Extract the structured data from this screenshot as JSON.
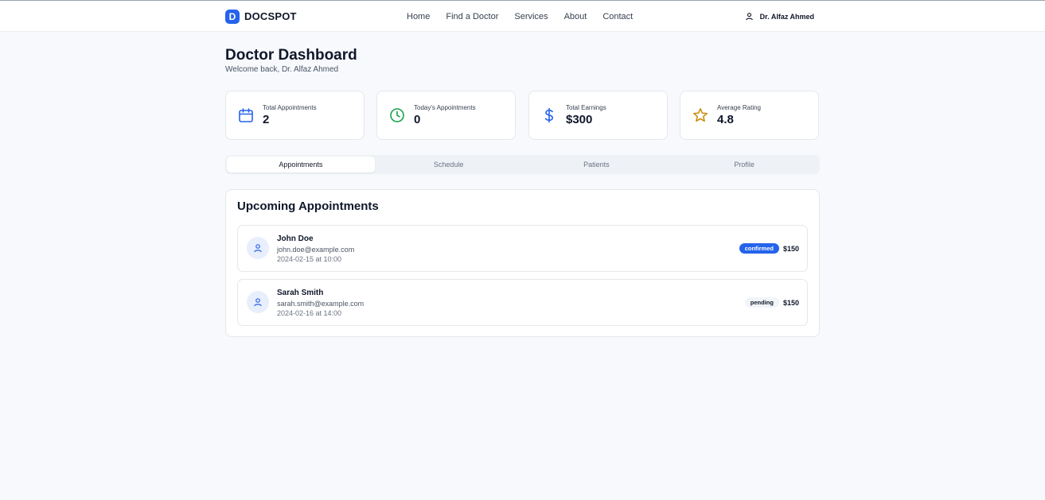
{
  "brand": {
    "logo_letter": "D",
    "name": "DOCSPOT"
  },
  "nav": {
    "links": [
      "Home",
      "Find a Doctor",
      "Services",
      "About",
      "Contact"
    ],
    "user_name": "Dr. Alfaz Ahmed"
  },
  "page": {
    "title": "Doctor Dashboard",
    "subtitle": "Welcome back, Dr. Alfaz Ahmed"
  },
  "stats": [
    {
      "label": "Total Appointments",
      "value": "2",
      "icon": "calendar-icon",
      "color": "#2563eb"
    },
    {
      "label": "Today's Appointments",
      "value": "0",
      "icon": "clock-icon",
      "color": "#16a34a"
    },
    {
      "label": "Total Earnings",
      "value": "$300",
      "icon": "dollar-icon",
      "color": "#2563eb"
    },
    {
      "label": "Average Rating",
      "value": "4.8",
      "icon": "star-icon",
      "color": "#ca8a04"
    }
  ],
  "tabs": [
    {
      "label": "Appointments",
      "active": true
    },
    {
      "label": "Schedule",
      "active": false
    },
    {
      "label": "Patients",
      "active": false
    },
    {
      "label": "Profile",
      "active": false
    }
  ],
  "appointments": {
    "title": "Upcoming Appointments",
    "items": [
      {
        "name": "John Doe",
        "email": "john.doe@example.com",
        "datetime": "2024-02-15 at 10:00",
        "status": "confirmed",
        "price": "$150"
      },
      {
        "name": "Sarah Smith",
        "email": "sarah.smith@example.com",
        "datetime": "2024-02-16 at 14:00",
        "status": "pending",
        "price": "$150"
      }
    ]
  },
  "colors": {
    "accent": "#2563eb",
    "background": "#f7f9fc",
    "success": "#16a34a",
    "rating": "#ca8a04"
  }
}
